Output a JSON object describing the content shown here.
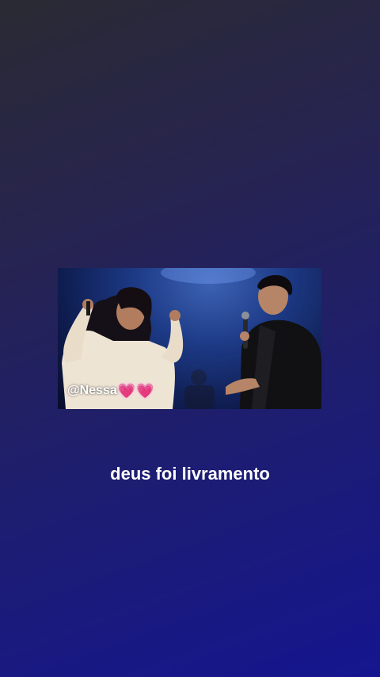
{
  "video": {
    "watermark_text": "@Nessa",
    "watermark_emoji": [
      "💗",
      "💗"
    ]
  },
  "caption": "deus foi livramento"
}
